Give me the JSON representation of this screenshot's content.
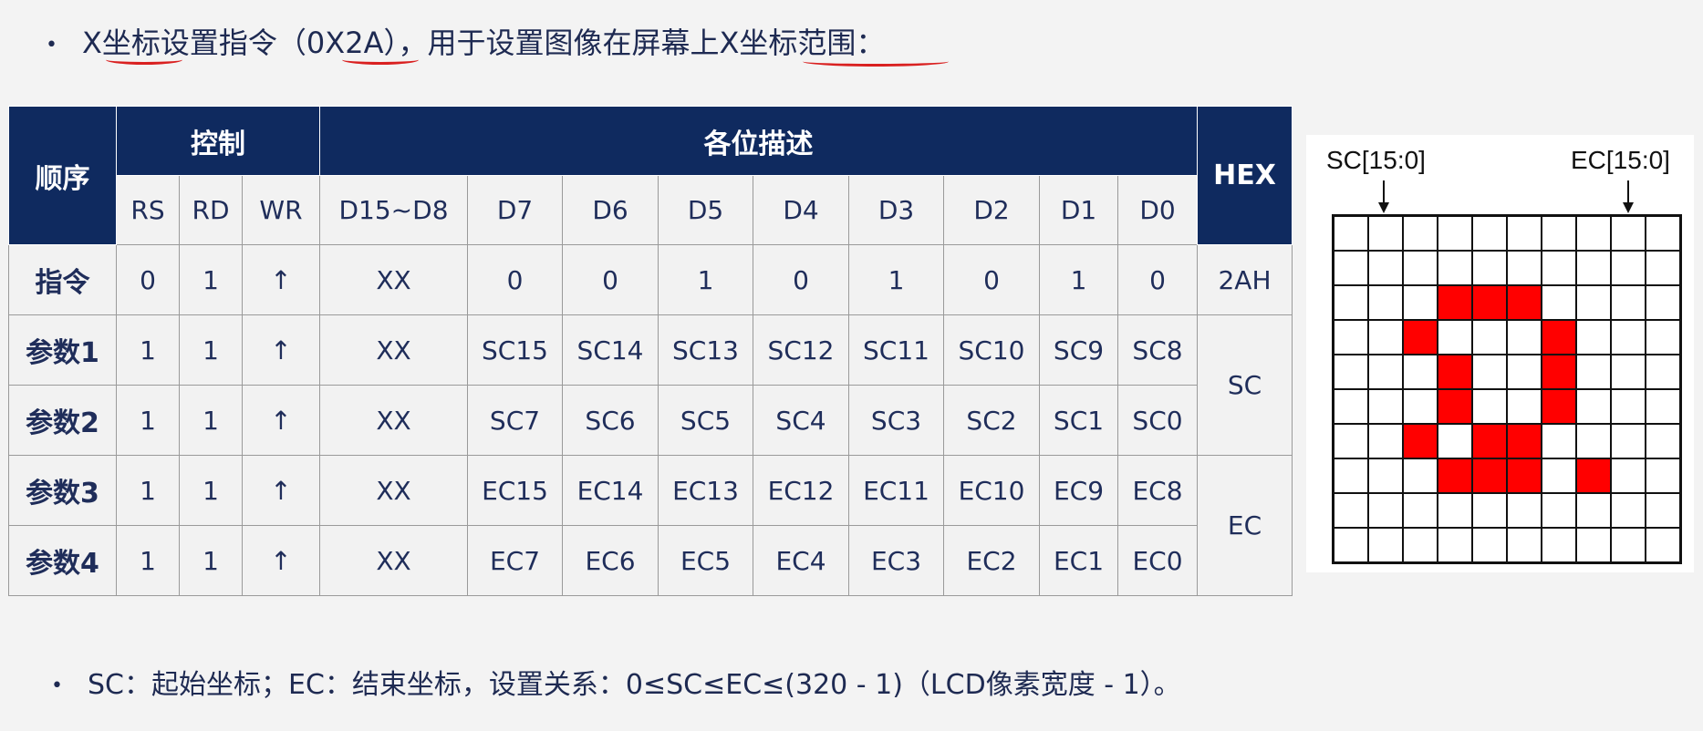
{
  "line1": {
    "bullet": "•",
    "text": "X坐标设置指令（0X2A），用于设置图像在屏幕上X坐标范围："
  },
  "line2": {
    "bullet": "•",
    "text": "SC：起始坐标；EC：结束坐标，设置关系：0≤SC≤EC≤(320 - 1)（LCD像素宽度 - 1）。"
  },
  "table": {
    "col_order": "顺序",
    "group_control": "控制",
    "group_bits": "各位描述",
    "col_hex": "HEX",
    "control_cols": [
      "RS",
      "RD",
      "WR"
    ],
    "bit_cols": [
      "D15~D8",
      "D7",
      "D6",
      "D5",
      "D4",
      "D3",
      "D2",
      "D1",
      "D0"
    ],
    "rows": [
      {
        "name": "指令",
        "cells": [
          "0",
          "1",
          "↑",
          "XX",
          "0",
          "0",
          "1",
          "0",
          "1",
          "0",
          "1",
          "0"
        ],
        "hex": "2AH"
      },
      {
        "name": "参数1",
        "cells": [
          "1",
          "1",
          "↑",
          "XX",
          "SC15",
          "SC14",
          "SC13",
          "SC12",
          "SC11",
          "SC10",
          "SC9",
          "SC8"
        ],
        "hex": "SC"
      },
      {
        "name": "参数2",
        "cells": [
          "1",
          "1",
          "↑",
          "XX",
          "SC7",
          "SC6",
          "SC5",
          "SC4",
          "SC3",
          "SC2",
          "SC1",
          "SC0"
        ]
      },
      {
        "name": "参数3",
        "cells": [
          "1",
          "1",
          "↑",
          "XX",
          "EC15",
          "EC14",
          "EC13",
          "EC12",
          "EC11",
          "EC10",
          "EC9",
          "EC8"
        ],
        "hex": "EC"
      },
      {
        "name": "参数4",
        "cells": [
          "1",
          "1",
          "↑",
          "XX",
          "EC7",
          "EC6",
          "EC5",
          "EC4",
          "EC3",
          "EC2",
          "EC1",
          "EC0"
        ]
      }
    ]
  },
  "diagram": {
    "sc_label": "SC[15:0]",
    "ec_label": "EC[15:0]",
    "grid_size": 10,
    "lit_color": "#ff0000",
    "lit_cells": [
      [
        2,
        3
      ],
      [
        2,
        4
      ],
      [
        2,
        5
      ],
      [
        3,
        2
      ],
      [
        3,
        6
      ],
      [
        4,
        3
      ],
      [
        4,
        6
      ],
      [
        5,
        3
      ],
      [
        5,
        6
      ],
      [
        6,
        2
      ],
      [
        6,
        4
      ],
      [
        6,
        5
      ],
      [
        7,
        3
      ],
      [
        7,
        4
      ],
      [
        7,
        5
      ],
      [
        7,
        7
      ]
    ]
  }
}
